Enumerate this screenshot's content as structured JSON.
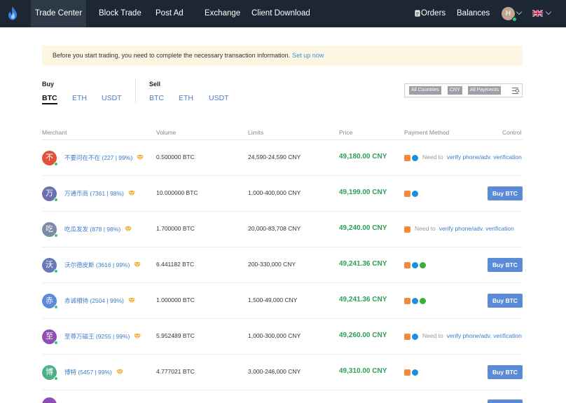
{
  "nav": {
    "items": [
      "Trade Center",
      "Block Trade",
      "Post Ad",
      "Exchange",
      "Client Download",
      "Orders",
      "Balances"
    ],
    "avatar_letter": "H"
  },
  "notice": {
    "text": "Before you start trading, you need to complete the necessary transaction information.",
    "link": "Set up now"
  },
  "buy": {
    "label": "Buy",
    "coins": [
      "BTC",
      "ETH",
      "USDT"
    ],
    "active": "BTC"
  },
  "sell": {
    "label": "Sell",
    "coins": [
      "BTC",
      "ETH",
      "USDT"
    ]
  },
  "filters": [
    "All Countries",
    "CNY",
    "All Payments"
  ],
  "table": {
    "headers": [
      "Merchant",
      "Volume",
      "Limits",
      "Price",
      "Payment Method",
      "Control"
    ],
    "need_text": "Need to",
    "need_link": "verify phone/adv. verification",
    "buy_label": "Buy BTC",
    "rows": [
      {
        "initial": "不",
        "color": "#e0533a",
        "merchant": "不要问在不在 (227 | 99%)",
        "volume": "0.500000 BTC",
        "limits": "24,590-24,590 CNY",
        "price": "49,180.00 CNY",
        "pay": [
          "bank",
          "ali"
        ],
        "control": "need"
      },
      {
        "initial": "万",
        "color": "#6d6fb0",
        "merchant": "万通币商 (7361 | 98%)",
        "volume": "10.000000 BTC",
        "limits": "1,000-400,000 CNY",
        "price": "49,199.00 CNY",
        "pay": [
          "bank",
          "ali"
        ],
        "control": "buy"
      },
      {
        "initial": "吃",
        "color": "#7a8aa8",
        "merchant": "吃瓜发发 (878 | 98%)",
        "volume": "1.700000 BTC",
        "limits": "20,000-83,708 CNY",
        "price": "49,240.00 CNY",
        "pay": [
          "bank"
        ],
        "control": "need"
      },
      {
        "initial": "沃",
        "color": "#6a78b8",
        "merchant": "沃尔德皮斯 (3616 | 99%)",
        "volume": "6.441182 BTC",
        "limits": "200-330,000 CNY",
        "price": "49,241.36 CNY",
        "pay": [
          "bank",
          "ali",
          "wx"
        ],
        "control": "buy"
      },
      {
        "initial": "赤",
        "color": "#5b8ad6",
        "merchant": "赤诚相待 (2504 | 99%)",
        "volume": "1.000000 BTC",
        "limits": "1,500-49,000 CNY",
        "price": "49,241.36 CNY",
        "pay": [
          "bank",
          "ali",
          "wx"
        ],
        "control": "buy"
      },
      {
        "initial": "至",
        "color": "#8e4fb0",
        "merchant": "至尊万磁王 (9255 | 99%)",
        "volume": "5.952489 BTC",
        "limits": "1,000-300,000 CNY",
        "price": "49,260.00 CNY",
        "pay": [
          "bank",
          "ali"
        ],
        "control": "need"
      },
      {
        "initial": "博",
        "color": "#4db08a",
        "merchant": "博特 (5457 | 99%)",
        "volume": "4.777021 BTC",
        "limits": "3,000-246,000 CNY",
        "price": "49,310.00 CNY",
        "pay": [
          "bank",
          "ali"
        ],
        "control": "buy"
      }
    ]
  }
}
